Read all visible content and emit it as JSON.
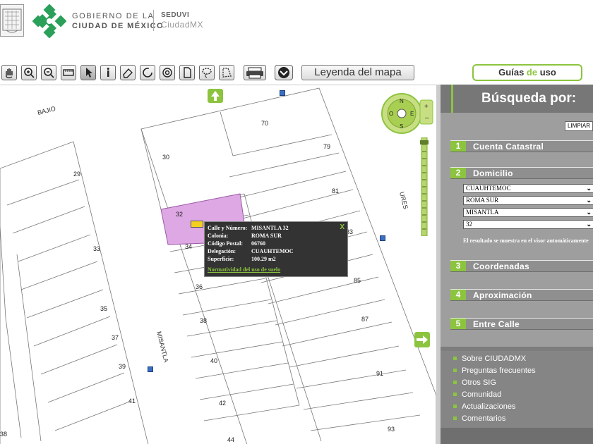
{
  "header": {
    "gov_line1": "GOBIERNO DE LA",
    "gov_line2": "CIUDAD DE MÉXICO",
    "org": "SEDUVI",
    "app": "CiudadMX"
  },
  "toolbar": {
    "tools": [
      "hand-icon",
      "zoom-in-icon",
      "zoom-out-icon",
      "ruler-icon",
      "pointer-icon",
      "info-icon",
      "eraser-icon",
      "refresh-icon",
      "target-icon",
      "document-icon",
      "lasso-icon",
      "polygon-icon",
      "print-icon",
      "download-icon"
    ],
    "legend_label": "Leyenda del mapa",
    "guides_pre": "Guías ",
    "guides_hl": "de",
    "guides_post": " uso"
  },
  "map": {
    "streets": {
      "bajio": "BAJIO",
      "misantla": "MISANTLA",
      "ures": "URES"
    },
    "lots": [
      "70",
      "79",
      "81",
      "83",
      "85",
      "87",
      "91",
      "93",
      "30",
      "32",
      "34",
      "36",
      "38",
      "40",
      "42",
      "44",
      "29",
      "33",
      "35",
      "37",
      "39",
      "41",
      "38"
    ],
    "selected_lot": "32",
    "compass": {
      "n": "N",
      "s": "S",
      "e": "E",
      "o": "O"
    },
    "popup": {
      "rows": [
        {
          "k": "Calle y Número:",
          "v": "MISANTLA 32"
        },
        {
          "k": "Colonia:",
          "v": "ROMA SUR"
        },
        {
          "k": "Código Postal:",
          "v": "06760"
        },
        {
          "k": "Delegación:",
          "v": "CUAUHTEMOC"
        },
        {
          "k": "Superficie:",
          "v": "100.29 m2"
        }
      ],
      "close": "X",
      "link": "Normatividad del uso de suelo"
    }
  },
  "panel": {
    "title": "Búsqueda por:",
    "clear": "LIMPIAR",
    "sections": [
      {
        "num": "1",
        "label": "Cuenta Catastral"
      },
      {
        "num": "2",
        "label": "Domicilio"
      },
      {
        "num": "3",
        "label": "Coordenadas"
      },
      {
        "num": "4",
        "label": "Aproximación"
      },
      {
        "num": "5",
        "label": "Entre Calle"
      }
    ],
    "selects": [
      "CUAUHTEMOC",
      "ROMA SUR",
      "MISANTLA",
      "32"
    ],
    "note": "El resultado se muestra en el visor automáticamente",
    "links": [
      "Sobre CIUDADMX",
      "Preguntas frecuentes",
      "Otros SIG",
      "Comunidad",
      "Actualizaciones",
      "Comentarios"
    ]
  },
  "colors": {
    "accent": "#8cc43f",
    "selected_lot": "#dda8e3",
    "panel": "#9e9e9e"
  }
}
